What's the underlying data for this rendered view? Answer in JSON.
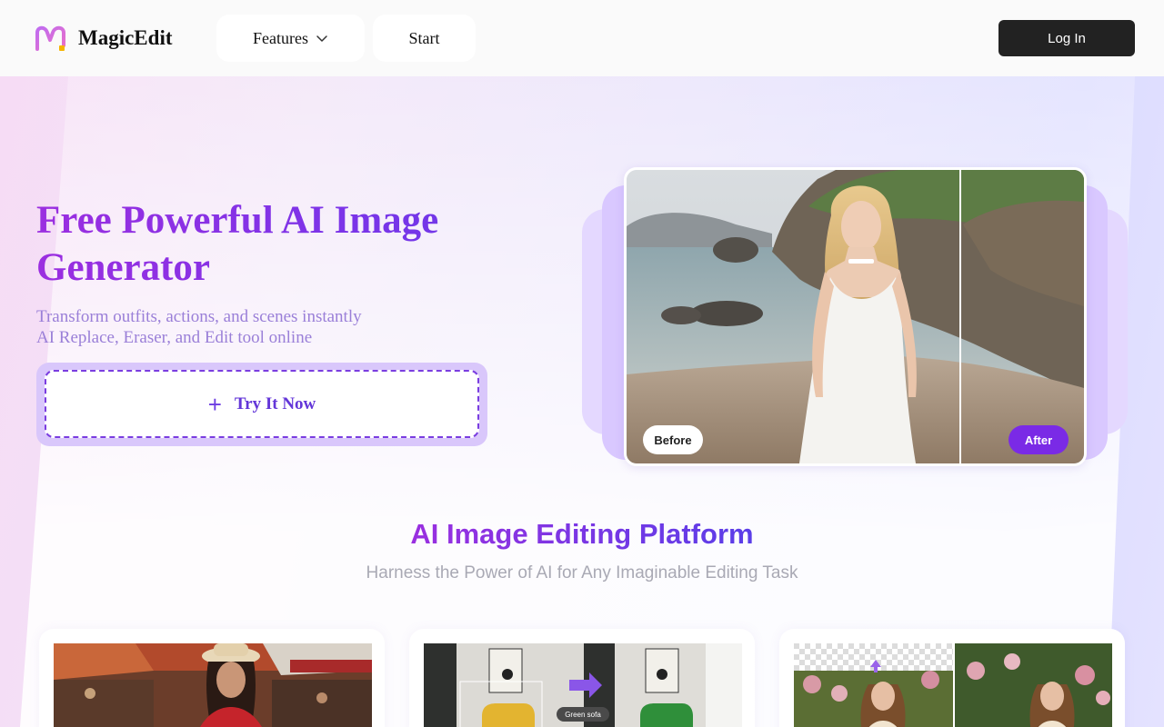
{
  "header": {
    "brand": "MagicEdit",
    "nav": [
      {
        "label": "Features"
      },
      {
        "label": "Start"
      }
    ],
    "login_label": "Log In"
  },
  "hero": {
    "title": "Free Powerful AI Image Generator",
    "subtitle_line1": "Transform outfits, actions, and scenes instantly",
    "subtitle_line2": "AI Replace, Eraser, and Edit tool online",
    "cta_label": "Try It Now",
    "before_label": "Before",
    "after_label": "After"
  },
  "platform": {
    "title": "AI Image Editing Platform",
    "subtitle": "Harness the Power of AI for Any Imaginable Editing Task",
    "card2_caption": "Green sofa"
  },
  "colors": {
    "accent": "#7a2ae6",
    "login_bg": "#222222",
    "title_gradient_start": "#9b2ee0",
    "title_gradient_end": "#6a3ae8"
  },
  "icons": {
    "logo": "magicedit-logo-icon",
    "features_chevron": "chevron-down-icon",
    "cta": "plus-icon"
  }
}
